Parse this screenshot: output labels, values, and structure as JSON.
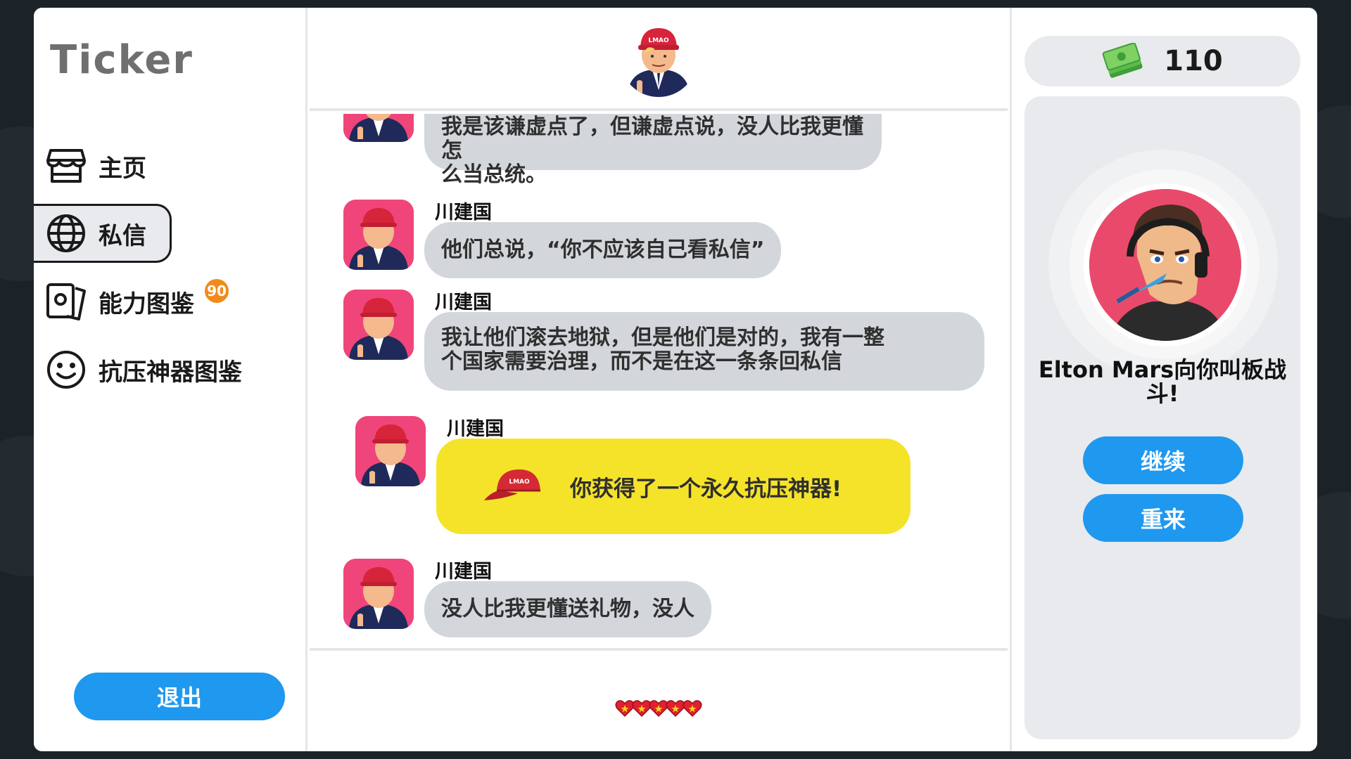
{
  "app": {
    "title": "Ticker"
  },
  "sidebar": {
    "items": [
      {
        "label": "主页",
        "icon": "store-icon"
      },
      {
        "label": "私信",
        "icon": "globe-icon",
        "active": true
      },
      {
        "label": "能力图鉴",
        "icon": "cards-icon",
        "badge": "90"
      },
      {
        "label": "抗压神器图鉴",
        "icon": "smiley-icon"
      }
    ],
    "logout_label": "退出"
  },
  "chat": {
    "contact_avatar": "maga-hat-avatar",
    "messages": [
      {
        "sender": "",
        "text_line1": "我是该谦虚点了，但谦虚点说，没人比我更懂怎",
        "text_line2": "么当总统。"
      },
      {
        "sender": "川建国",
        "text": "他们总说，“你不应该自己看私信”"
      },
      {
        "sender": "川建国",
        "text_line1": "我让他们滚去地狱，但是他们是对的，我有一整",
        "text_line2": "个国家需要治理，而不是在这一条条回私信"
      },
      {
        "sender": "川建国",
        "gift_text": "你获得了一个永久抗压神器!",
        "gift_icon": "red-cap-icon"
      },
      {
        "sender": "川建国",
        "text": "没人比我更懂送礼物，没人"
      }
    ],
    "hearts_count": 5
  },
  "right_panel": {
    "money": "110",
    "money_icon": "cash-stack-icon",
    "opponent_name_line1": "Elton Mars向你叫板战",
    "opponent_name_line2": "斗!",
    "continue_label": "继续",
    "restart_label": "重来"
  },
  "colors": {
    "accent": "#1f98ef",
    "gift_bubble": "#f5e32a",
    "bubble": "#d3d7db",
    "badge": "#f28a1a"
  }
}
